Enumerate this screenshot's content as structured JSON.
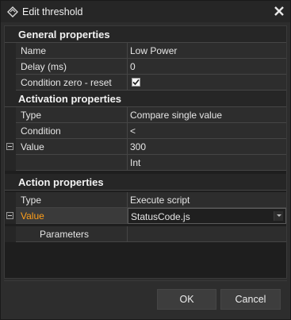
{
  "window": {
    "title": "Edit threshold"
  },
  "categories": {
    "general": "General properties",
    "activation": "Activation properties",
    "action": "Action properties"
  },
  "general": {
    "name_label": "Name",
    "name_value": "Low Power",
    "delay_label": "Delay (ms)",
    "delay_value": "0",
    "zero_reset_label": "Condition zero - reset",
    "zero_reset_checked": true
  },
  "activation": {
    "type_label": "Type",
    "type_value": "Compare single value",
    "condition_label": "Condition",
    "condition_value": "<",
    "value_label": "Value",
    "value_value": "300",
    "value_type": "Int"
  },
  "action": {
    "type_label": "Type",
    "type_value": "Execute script",
    "value_label": "Value",
    "value_value": "StatusCode.js",
    "parameters_label": "Parameters",
    "parameters_value": ""
  },
  "buttons": {
    "ok": "OK",
    "cancel": "Cancel"
  },
  "colors": {
    "accent_label": "#ff9f1a",
    "background": "#2d2d2d",
    "grid_line": "#454545"
  }
}
